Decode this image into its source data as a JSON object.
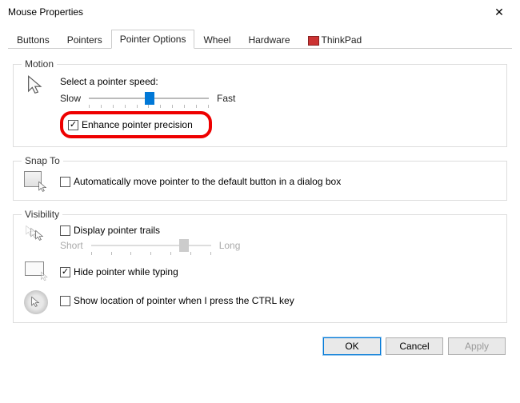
{
  "title": "Mouse Properties",
  "tabs": {
    "buttons": "Buttons",
    "pointers": "Pointers",
    "pointer_options": "Pointer Options",
    "wheel": "Wheel",
    "hardware": "Hardware",
    "thinkpad": "ThinkPad"
  },
  "motion": {
    "legend": "Motion",
    "speed_label": "Select a pointer speed:",
    "slow": "Slow",
    "fast": "Fast",
    "enhance": "Enhance pointer precision"
  },
  "snap": {
    "legend": "Snap To",
    "auto_move": "Automatically move pointer to the default button in a dialog box"
  },
  "visibility": {
    "legend": "Visibility",
    "trails": "Display pointer trails",
    "short": "Short",
    "long": "Long",
    "hide_typing": "Hide pointer while typing",
    "ctrl_locate": "Show location of pointer when I press the CTRL key"
  },
  "buttons_bar": {
    "ok": "OK",
    "cancel": "Cancel",
    "apply": "Apply"
  }
}
